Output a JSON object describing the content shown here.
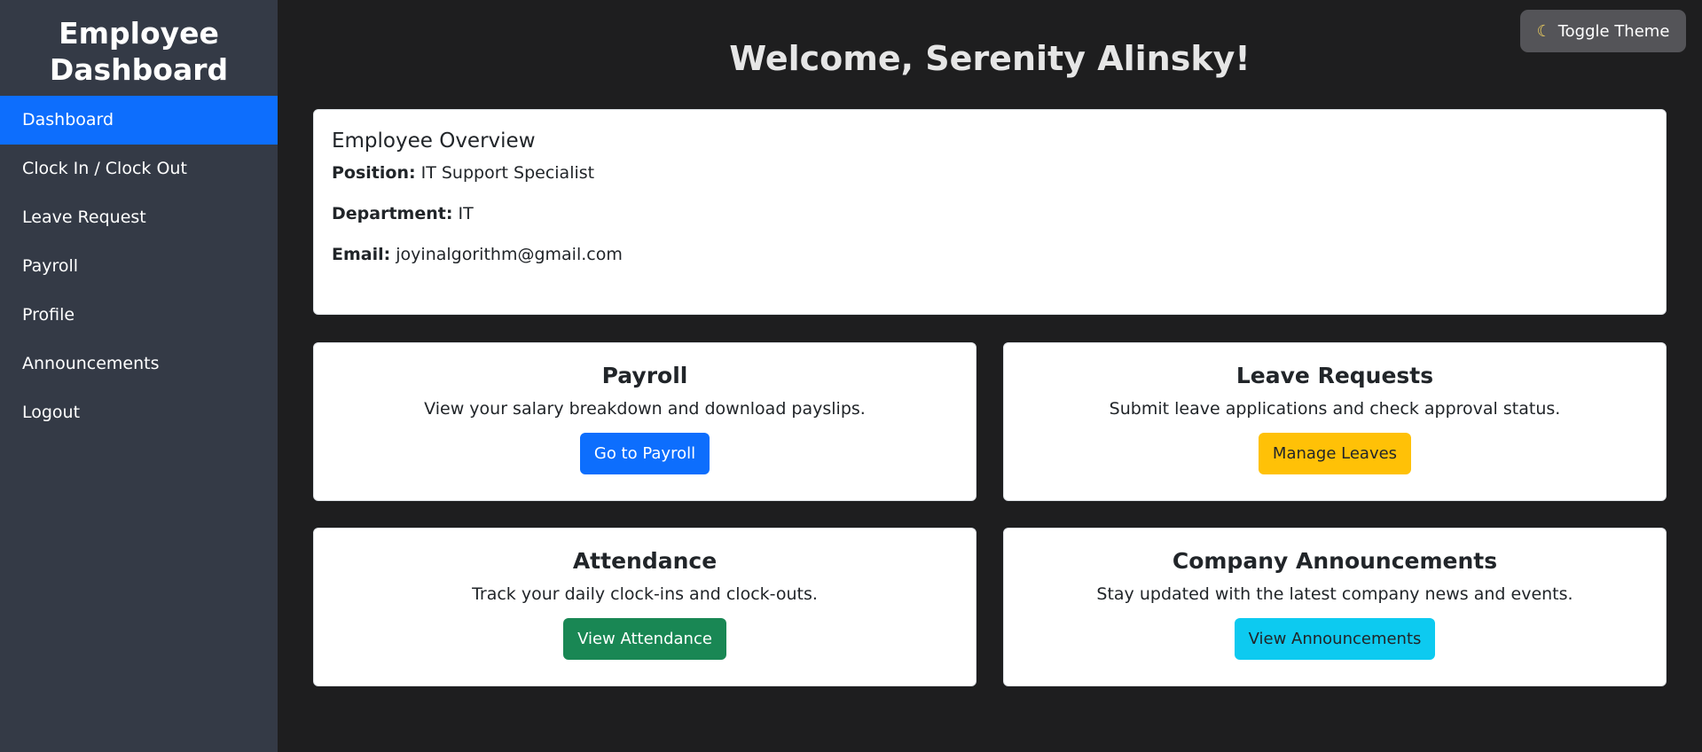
{
  "sidebar": {
    "brand": "Employee Dashboard",
    "items": [
      {
        "label": "Dashboard"
      },
      {
        "label": "Clock In / Clock Out"
      },
      {
        "label": "Leave Request"
      },
      {
        "label": "Payroll"
      },
      {
        "label": "Profile"
      },
      {
        "label": "Announcements"
      },
      {
        "label": "Logout"
      }
    ],
    "active_index": 0
  },
  "header": {
    "toggle_theme_icon": "moon-icon",
    "toggle_theme_label": "Toggle Theme",
    "welcome": "Welcome, Serenity Alinsky!"
  },
  "overview": {
    "title": "Employee Overview",
    "position_label": "Position:",
    "position_value": "IT Support Specialist",
    "department_label": "Department:",
    "department_value": "IT",
    "email_label": "Email:",
    "email_value": "joyinalgorithm@gmail.com"
  },
  "cards": {
    "payroll": {
      "title": "Payroll",
      "desc": "View your salary breakdown and download payslips.",
      "button": "Go to Payroll"
    },
    "leave": {
      "title": "Leave Requests",
      "desc": "Submit leave applications and check approval status.",
      "button": "Manage Leaves"
    },
    "attendance": {
      "title": "Attendance",
      "desc": "Track your daily clock-ins and clock-outs.",
      "button": "View Attendance"
    },
    "announcements": {
      "title": "Company Announcements",
      "desc": "Stay updated with the latest company news and events.",
      "button": "View Announcements"
    }
  },
  "colors": {
    "sidebar_bg": "#343a46",
    "page_bg": "#1e1e1f",
    "primary": "#0d6efd",
    "warning": "#ffc107",
    "success": "#198754",
    "info": "#0dcaf0"
  }
}
